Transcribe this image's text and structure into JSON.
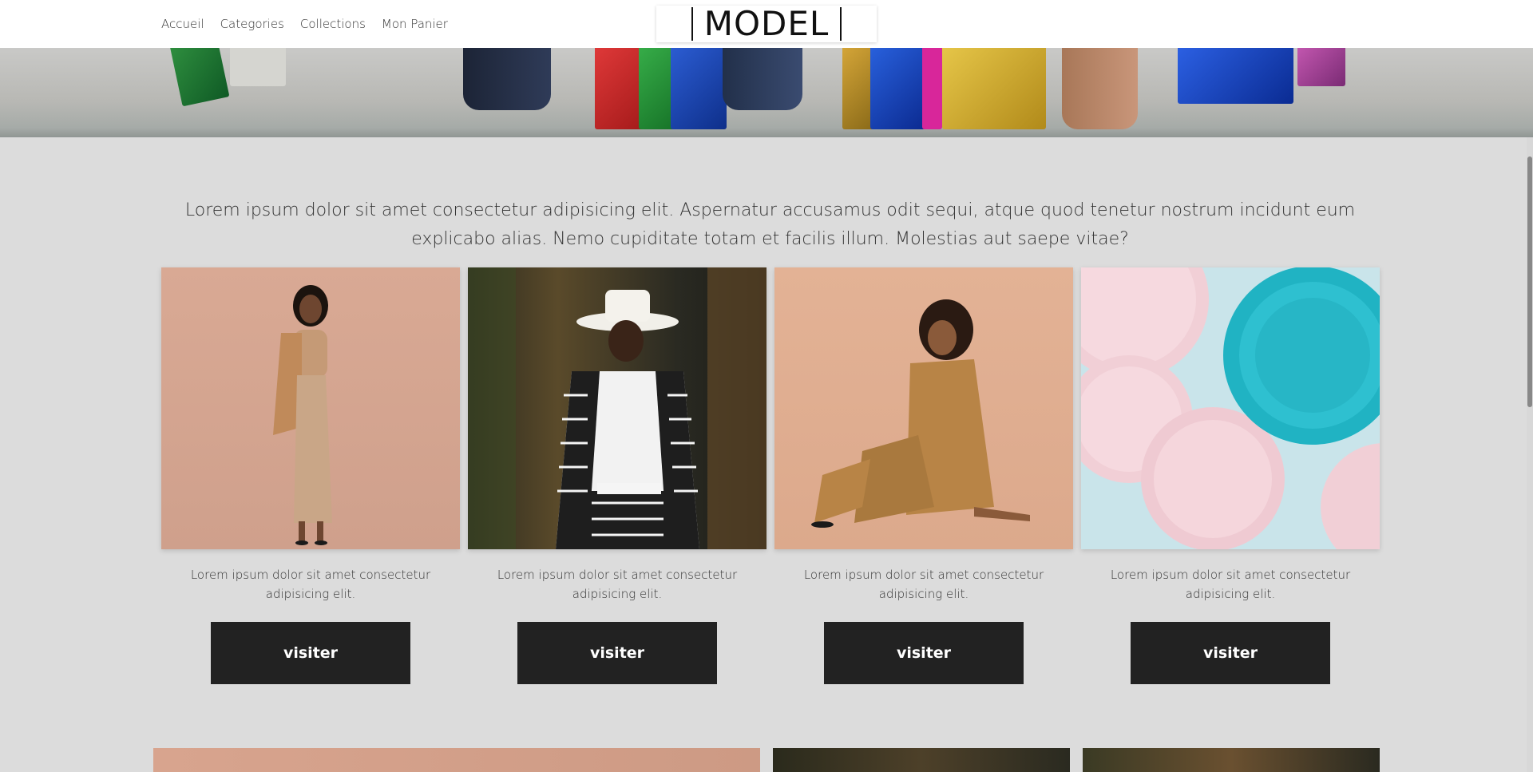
{
  "nav": {
    "items": [
      {
        "label": "Accueil"
      },
      {
        "label": "Categories"
      },
      {
        "label": "Collections"
      },
      {
        "label": "Mon Panier"
      }
    ]
  },
  "logo": {
    "text": "MODEL"
  },
  "intro": {
    "text": "Lorem ipsum dolor sit amet consectetur adipisicing elit. Aspernatur accusamus odit sequi, atque quod tenetur nostrum incidunt eum explicabo alias. Nemo cupiditate totam et facilis illum. Molestias aut saepe vitae?"
  },
  "cards": [
    {
      "desc": "Lorem ipsum dolor sit amet consectetur adipisicing elit.",
      "button": "visiter",
      "image": "woman-in-beige-dress-photo"
    },
    {
      "desc": "Lorem ipsum dolor sit amet consectetur adipisicing elit.",
      "button": "visiter",
      "image": "woman-in-white-hat-photo"
    },
    {
      "desc": "Lorem ipsum dolor sit amet consectetur adipisicing elit.",
      "button": "visiter",
      "image": "woman-in-satin-suit-photo"
    },
    {
      "desc": "Lorem ipsum dolor sit amet consectetur adipisicing elit.",
      "button": "visiter",
      "image": "pink-and-blue-plates-photo"
    }
  ],
  "colors": {
    "page_bg": "#dcdcdc",
    "header_bg": "#ffffff",
    "button_bg": "#222222",
    "button_text": "#ffffff"
  }
}
